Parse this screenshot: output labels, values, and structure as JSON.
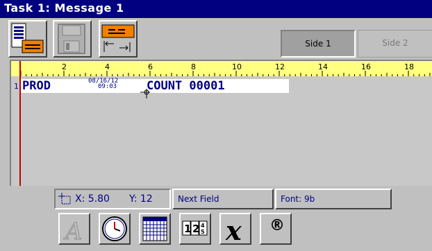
{
  "window": {
    "title": "Task 1: Message 1"
  },
  "toolbar": {
    "side1_label": "Side 1",
    "side2_label": "Side 2"
  },
  "ruler": {
    "ticks": [
      "2",
      "4",
      "6",
      "8",
      "10",
      "12",
      "14",
      "16",
      "18"
    ]
  },
  "message": {
    "line_number": "1",
    "field_text": "PROD",
    "date": "08/16/12",
    "time": "09:03",
    "counter": "COUNT 00001"
  },
  "status": {
    "x": "X: 5.80",
    "y": "Y: 12",
    "next_field": "Next Field",
    "font": "Font: 9b"
  },
  "bottom_toolbar": {
    "registered_glyph": "®"
  }
}
